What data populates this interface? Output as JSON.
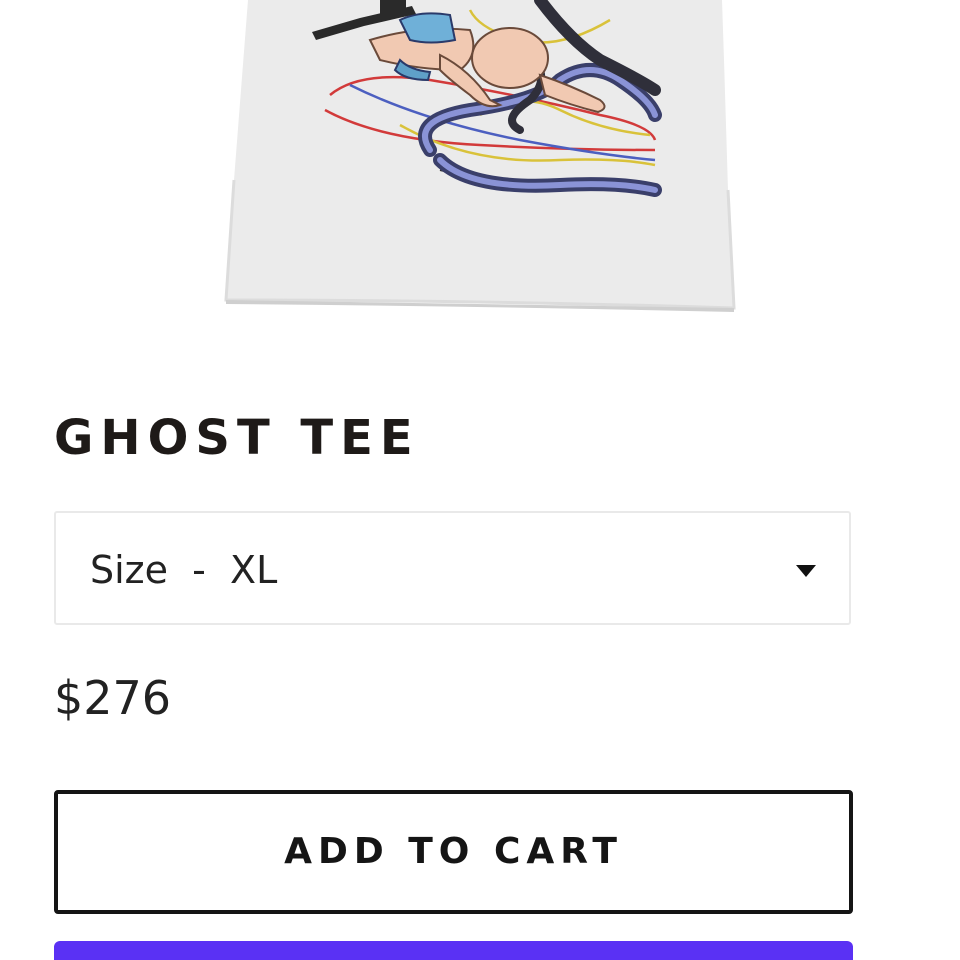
{
  "product": {
    "title": "GHOST TEE",
    "image_alt": "product-photo",
    "size_selector": {
      "selected_text": "Size  -  XL"
    },
    "price": "$276",
    "add_to_cart_label": "ADD TO CART"
  },
  "colors": {
    "text_dark": "#1e1a18",
    "buy_button": "#5a31f4",
    "border_light": "#e9e9e9"
  },
  "icons": {
    "dropdown": "chevron-down-icon"
  }
}
